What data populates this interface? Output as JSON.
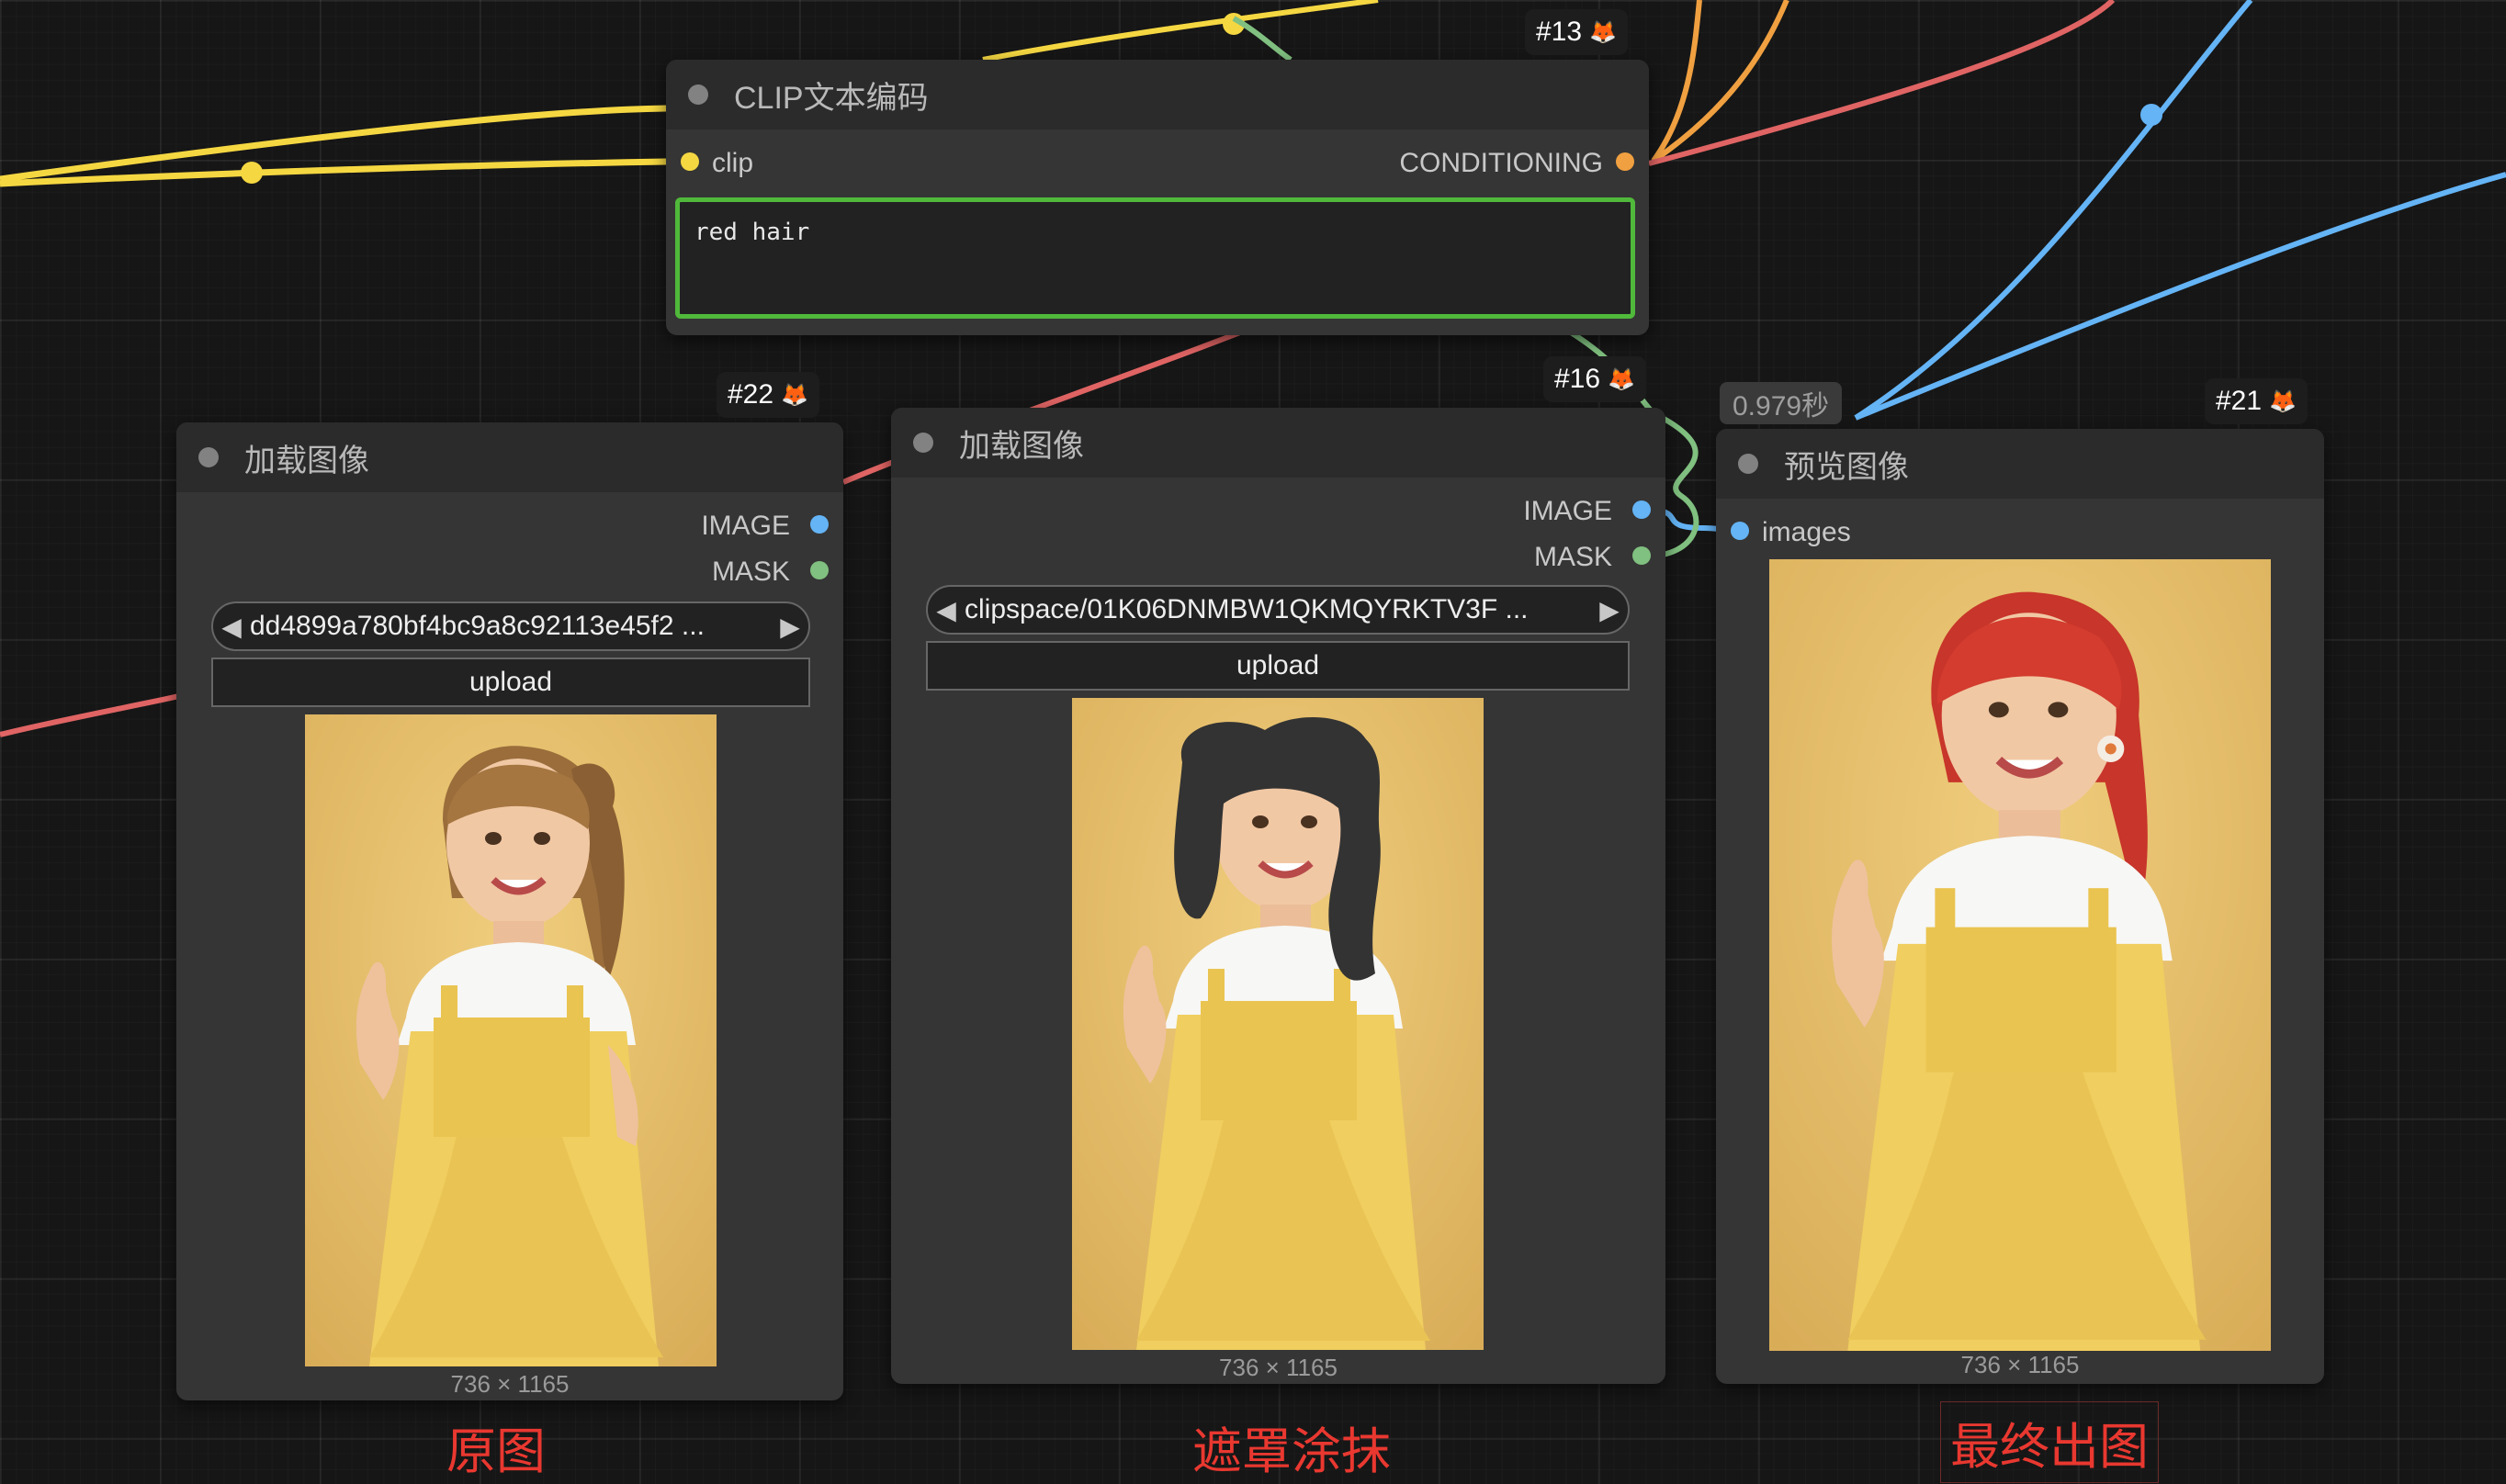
{
  "nodes": {
    "clip": {
      "id": "#13",
      "title": "CLIP文本编码",
      "input": "clip",
      "output": "CONDITIONING",
      "text": "red hair"
    },
    "load_original": {
      "id": "#22",
      "title": "加载图像",
      "outputs": [
        "IMAGE",
        "MASK"
      ],
      "file": "dd4899a780bf4bc9a8c92113e45f2 ...",
      "upload": "upload",
      "dims": "736 × 1165"
    },
    "load_masked": {
      "id": "#16",
      "title": "加载图像",
      "outputs": [
        "IMAGE",
        "MASK"
      ],
      "file": "clipspace/01K06DNMBW1QKMQYRKTV3F ...",
      "upload": "upload",
      "dims": "736 × 1165"
    },
    "preview": {
      "id": "#21",
      "title": "预览图像",
      "time": "0.979秒",
      "input": "images",
      "dims": "736 × 1165"
    }
  },
  "captions": {
    "original": "原图",
    "mask": "遮罩涂抹",
    "final": "最终出图"
  },
  "colors": {
    "clip_wire": "#f5d742",
    "conditioning_wire": "#e06464",
    "image_wire": "#64b4f6",
    "mask_wire": "#80c080",
    "textbox_border": "#50b93b",
    "caption": "#e93830"
  },
  "icons": [
    "fox-icon",
    "left-arrow-icon",
    "right-arrow-icon"
  ]
}
